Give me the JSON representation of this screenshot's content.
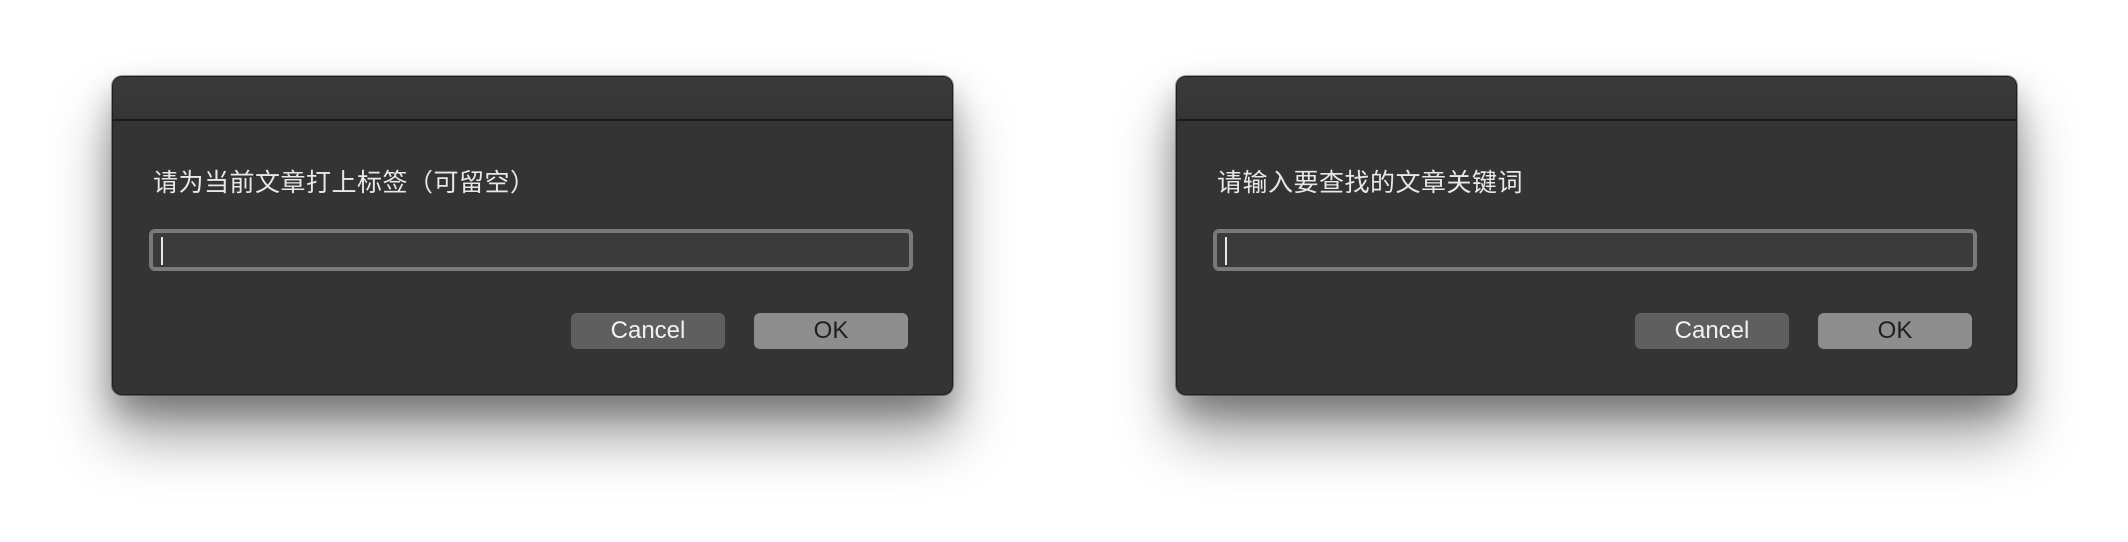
{
  "dialogs": [
    {
      "prompt": "请为当前文章打上标签（可留空）",
      "input_value": "",
      "cancel_label": "Cancel",
      "ok_label": "OK"
    },
    {
      "prompt": "请输入要查找的文章关键词",
      "input_value": "",
      "cancel_label": "Cancel",
      "ok_label": "OK"
    }
  ],
  "colors": {
    "dialog_background": "#343434",
    "field_border": "#7a7a7a",
    "cancel_button": "#5f5f5f",
    "ok_button": "#8e8e8e",
    "text": "#e8e8e8"
  }
}
